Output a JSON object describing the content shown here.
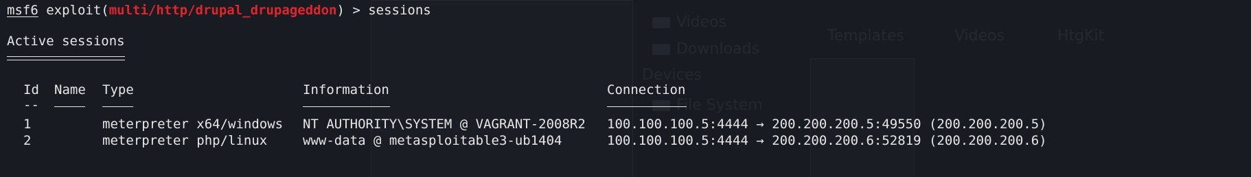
{
  "prompt": {
    "msf": "msf6",
    "exploit_open": " exploit(",
    "module": "multi/http/drupal_drupageddon",
    "exploit_close": ") > ",
    "command": "sessions"
  },
  "heading": "Active sessions",
  "columns": {
    "id": "Id",
    "name": "Name",
    "type": "Type",
    "information": "Information",
    "connection": "Connection",
    "id_dash": "--"
  },
  "sessions": [
    {
      "id": "1",
      "name": "",
      "type": "meterpreter x64/windows",
      "information": "NT AUTHORITY\\SYSTEM @ VAGRANT-2008R2",
      "connection": "100.100.100.5:4444 → 200.200.200.5:49550 (200.200.200.5)"
    },
    {
      "id": "2",
      "name": "",
      "type": "meterpreter php/linux",
      "information": "www-data @ metasploitable3-ub1404",
      "connection": "100.100.100.5:4444 → 200.200.200.6:52819 (200.200.200.6)"
    }
  ],
  "background": {
    "videos": "Videos",
    "downloads": "Downloads",
    "devices": "Devices",
    "file_system": "File System",
    "templates": "Templates",
    "videos_tab": "Videos",
    "htgkit": "HtgKit"
  },
  "colors": {
    "background": "#191b22",
    "text": "#e7e7e7",
    "module": "#e0262b"
  }
}
